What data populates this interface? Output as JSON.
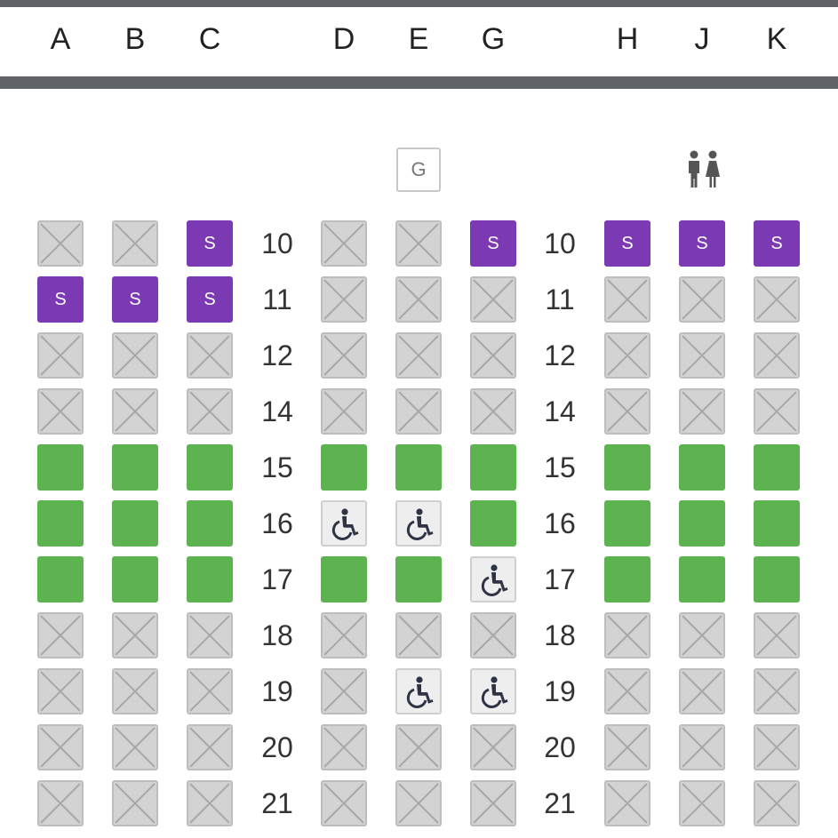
{
  "header": {
    "columns": [
      "A",
      "B",
      "C",
      "D",
      "E",
      "G",
      "H",
      "J",
      "K"
    ]
  },
  "facilities": {
    "galley_label": "G",
    "lavatory_icon": "lavatory-icon"
  },
  "legend_symbols": {
    "premium_label": "S"
  },
  "colors": {
    "bar": "#5f6368",
    "available": "#5cb350",
    "premium": "#7b3ab3",
    "unavailable": "#d3d3d3",
    "accessible_bg": "#eeeeee"
  },
  "rows": [
    {
      "number": "10",
      "seats": [
        "x",
        "x",
        "s",
        "x",
        "x",
        "s",
        "s",
        "s",
        "s"
      ]
    },
    {
      "number": "11",
      "seats": [
        "s",
        "s",
        "s",
        "x",
        "x",
        "x",
        "x",
        "x",
        "x"
      ]
    },
    {
      "number": "12",
      "seats": [
        "x",
        "x",
        "x",
        "x",
        "x",
        "x",
        "x",
        "x",
        "x"
      ]
    },
    {
      "number": "14",
      "seats": [
        "x",
        "x",
        "x",
        "x",
        "x",
        "x",
        "x",
        "x",
        "x"
      ]
    },
    {
      "number": "15",
      "seats": [
        "a",
        "a",
        "a",
        "a",
        "a",
        "a",
        "a",
        "a",
        "a"
      ]
    },
    {
      "number": "16",
      "seats": [
        "a",
        "a",
        "a",
        "w",
        "w",
        "a",
        "a",
        "a",
        "a"
      ]
    },
    {
      "number": "17",
      "seats": [
        "a",
        "a",
        "a",
        "a",
        "a",
        "w",
        "a",
        "a",
        "a"
      ]
    },
    {
      "number": "18",
      "seats": [
        "x",
        "x",
        "x",
        "x",
        "x",
        "x",
        "x",
        "x",
        "x"
      ]
    },
    {
      "number": "19",
      "seats": [
        "x",
        "x",
        "x",
        "x",
        "w",
        "w",
        "x",
        "x",
        "x"
      ]
    },
    {
      "number": "20",
      "seats": [
        "x",
        "x",
        "x",
        "x",
        "x",
        "x",
        "x",
        "x",
        "x"
      ]
    },
    {
      "number": "21",
      "seats": [
        "x",
        "x",
        "x",
        "x",
        "x",
        "x",
        "x",
        "x",
        "x"
      ]
    }
  ]
}
